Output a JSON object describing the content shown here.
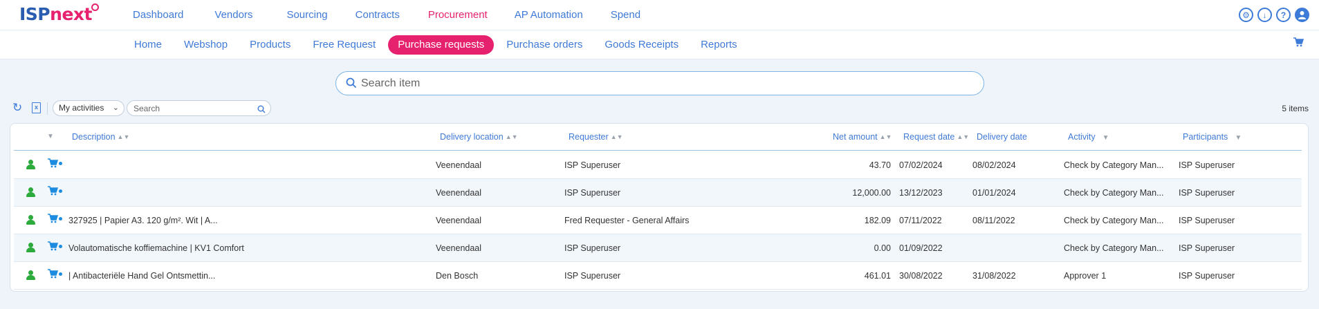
{
  "app": {
    "logo_main": "ISP",
    "logo_accent": "next"
  },
  "mainnav": {
    "items": [
      "Dashboard",
      "Vendors",
      "Sourcing",
      "Contracts",
      "Procurement",
      "AP Automation",
      "Spend"
    ],
    "active": "Procurement"
  },
  "topicons": [
    "settings-icon",
    "download-icon",
    "help-icon",
    "user-icon"
  ],
  "subnav": {
    "items": [
      "Home",
      "Webshop",
      "Products",
      "Free Request",
      "Purchase requests",
      "Purchase orders",
      "Goods Receipts",
      "Reports"
    ],
    "active": "Purchase requests"
  },
  "search": {
    "placeholder": "Search item"
  },
  "toolbar": {
    "filter_value": "My activities",
    "search_placeholder": "Search",
    "count": "5 items"
  },
  "table": {
    "columns": {
      "description": "Description",
      "delivery_location": "Delivery location",
      "requester": "Requester",
      "net_amount": "Net amount",
      "request_date": "Request date",
      "delivery_date": "Delivery date",
      "activity": "Activity",
      "participants": "Participants"
    },
    "rows": [
      {
        "description": "",
        "delivery_location": "Veenendaal",
        "requester": "ISP Superuser",
        "net_amount": "43.70",
        "request_date": "07/02/2024",
        "delivery_date": "08/02/2024",
        "activity": "Check by Category Man...",
        "participants": "ISP Superuser"
      },
      {
        "description": "",
        "delivery_location": "Veenendaal",
        "requester": "ISP Superuser",
        "net_amount": "12,000.00",
        "request_date": "13/12/2023",
        "delivery_date": "01/01/2024",
        "activity": "Check by Category Man...",
        "participants": "ISP Superuser"
      },
      {
        "description": "327925 | Papier A3. 120 g/m². Wit | A...",
        "delivery_location": "Veenendaal",
        "requester": "Fred Requester - General Affairs",
        "net_amount": "182.09",
        "request_date": "07/11/2022",
        "delivery_date": "08/11/2022",
        "activity": "Check by Category Man...",
        "participants": "ISP Superuser"
      },
      {
        "description": "Volautomatische koffiemachine | KV1 Comfort",
        "delivery_location": "Veenendaal",
        "requester": "ISP Superuser",
        "net_amount": "0.00",
        "request_date": "01/09/2022",
        "delivery_date": "",
        "activity": "Check by Category Man...",
        "participants": "ISP Superuser"
      },
      {
        "description": "| Antibacteriële Hand Gel Ontsmettin...",
        "delivery_location": "Den Bosch",
        "requester": "ISP Superuser",
        "net_amount": "461.01",
        "request_date": "30/08/2022",
        "delivery_date": "31/08/2022",
        "activity": "Approver 1",
        "participants": "ISP Superuser"
      }
    ]
  },
  "colors": {
    "brand_blue": "#2a5db0",
    "brand_pink": "#e6226e",
    "link_blue": "#3f7ad8",
    "status_green": "#2cab3c"
  }
}
